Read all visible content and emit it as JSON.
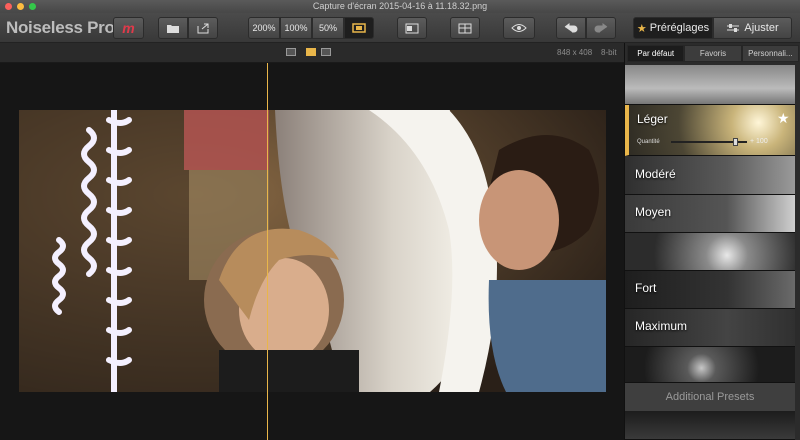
{
  "window": {
    "title": "Capture d'écran 2015-04-16 à 11.18.32.png"
  },
  "app": {
    "name": "Noiseless Pro"
  },
  "toolbar": {
    "zoom_200": "200%",
    "zoom_100": "100%",
    "zoom_50": "50%",
    "presets_label": "Préréglages",
    "adjust_label": "Ajuster"
  },
  "image_info": {
    "dimensions": "848 x 408",
    "bit_depth": "8-bit"
  },
  "panel": {
    "tabs": [
      "Par défaut",
      "Favoris",
      "Personnali..."
    ],
    "presets": [
      {
        "label": ""
      },
      {
        "label": "Léger",
        "quantity_label": "Quantité",
        "quantity_value": "+ 100",
        "quantity_level": 0.88
      },
      {
        "label": "Modéré"
      },
      {
        "label": "Moyen"
      },
      {
        "label": ""
      },
      {
        "label": "Fort"
      },
      {
        "label": "Maximum"
      },
      {
        "label": ""
      }
    ],
    "additional_presets": "Additional Presets"
  },
  "colors": {
    "accent": "#e9b64a",
    "logo_red": "#e03a4a",
    "split_line": "#e9b64a"
  }
}
